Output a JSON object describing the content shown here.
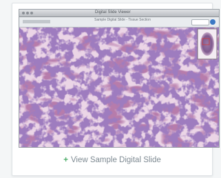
{
  "window": {
    "title": "Digital Slide Viewer",
    "toolbar_text": "Sample Digital Slide - Tissue Section"
  },
  "zoom_controls": {
    "magnification_label": "40x"
  },
  "caption": {
    "icon": "plus-icon",
    "label": "View Sample Digital Slide"
  },
  "colors": {
    "tissue_base": "#b77cab",
    "stroma": "#e3c4dc",
    "nuclei": "#5a3a86",
    "caption_text": "#7e8a92",
    "plus_icon": "#4fae6b",
    "accent_button": "#3b78c4"
  }
}
